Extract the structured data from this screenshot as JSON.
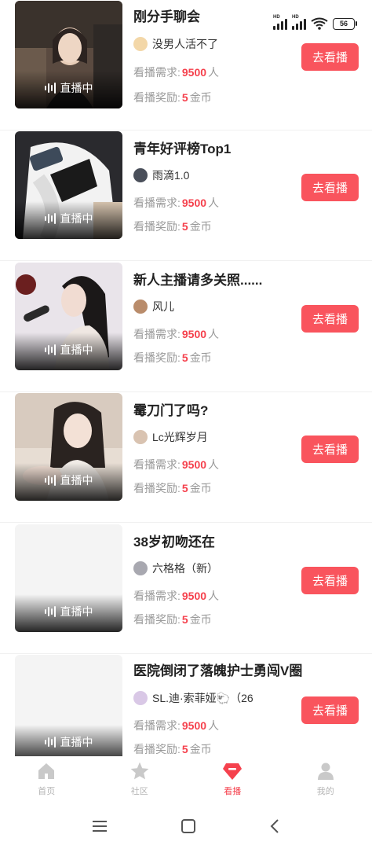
{
  "status": {
    "battery": "56",
    "hd_label": "HD"
  },
  "labels": {
    "live": "直播中",
    "demand_prefix": "看播需求:",
    "demand_unit": "人",
    "reward_prefix": "看播奖励:",
    "reward_unit": "金币",
    "watch_button": "去看播"
  },
  "cards": [
    {
      "title": "刚分手聊会",
      "author": "没男人活不了",
      "demand": "9500",
      "reward": "5"
    },
    {
      "title": "青年好评榜Top1",
      "author": "雨滴1.0",
      "demand": "9500",
      "reward": "5"
    },
    {
      "title": "新人主播请多关照......",
      "author": "风儿",
      "demand": "9500",
      "reward": "5"
    },
    {
      "title": "霉刀门了吗?",
      "author": "Lc光辉岁月",
      "demand": "9500",
      "reward": "5"
    },
    {
      "title": "38岁初吻还在",
      "author": "六格格（新）",
      "demand": "9500",
      "reward": "5"
    },
    {
      "title": "医院倒闭了落魄护士勇闯V圈",
      "author": "SL.迪·索菲娅🐑（26",
      "demand": "9500",
      "reward": "5"
    }
  ],
  "tabs": [
    {
      "label": "首页",
      "icon": "home-icon",
      "active": false
    },
    {
      "label": "社区",
      "icon": "star-icon",
      "active": false
    },
    {
      "label": "看播",
      "icon": "gem-icon",
      "active": true
    },
    {
      "label": "我的",
      "icon": "person-icon",
      "active": false
    }
  ],
  "colors": {
    "accent": "#f9545d",
    "highlight": "#f5414d",
    "muted": "#999999"
  }
}
